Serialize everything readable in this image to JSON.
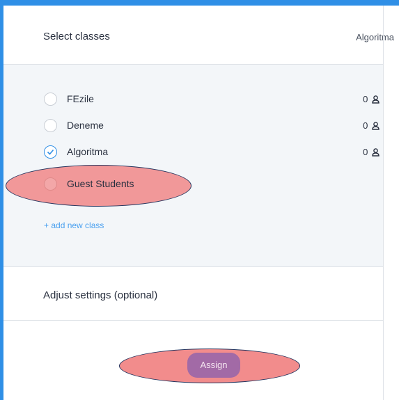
{
  "header": {
    "title": "Select classes",
    "right_label": "Algoritma"
  },
  "classes": [
    {
      "label": "FEzile",
      "count": "0",
      "checked": false
    },
    {
      "label": "Deneme",
      "count": "0",
      "checked": false
    },
    {
      "label": "Algoritma",
      "count": "0",
      "checked": true
    },
    {
      "label": "Guest Students",
      "count": "",
      "checked": false
    }
  ],
  "add_class_label": "+ add new class",
  "settings": {
    "title": "Adjust settings (optional)"
  },
  "assign_label": "Assign",
  "colors": {
    "accent": "#2f8fe6",
    "assign_button": "#a26aa6",
    "highlight": "#f07878"
  }
}
